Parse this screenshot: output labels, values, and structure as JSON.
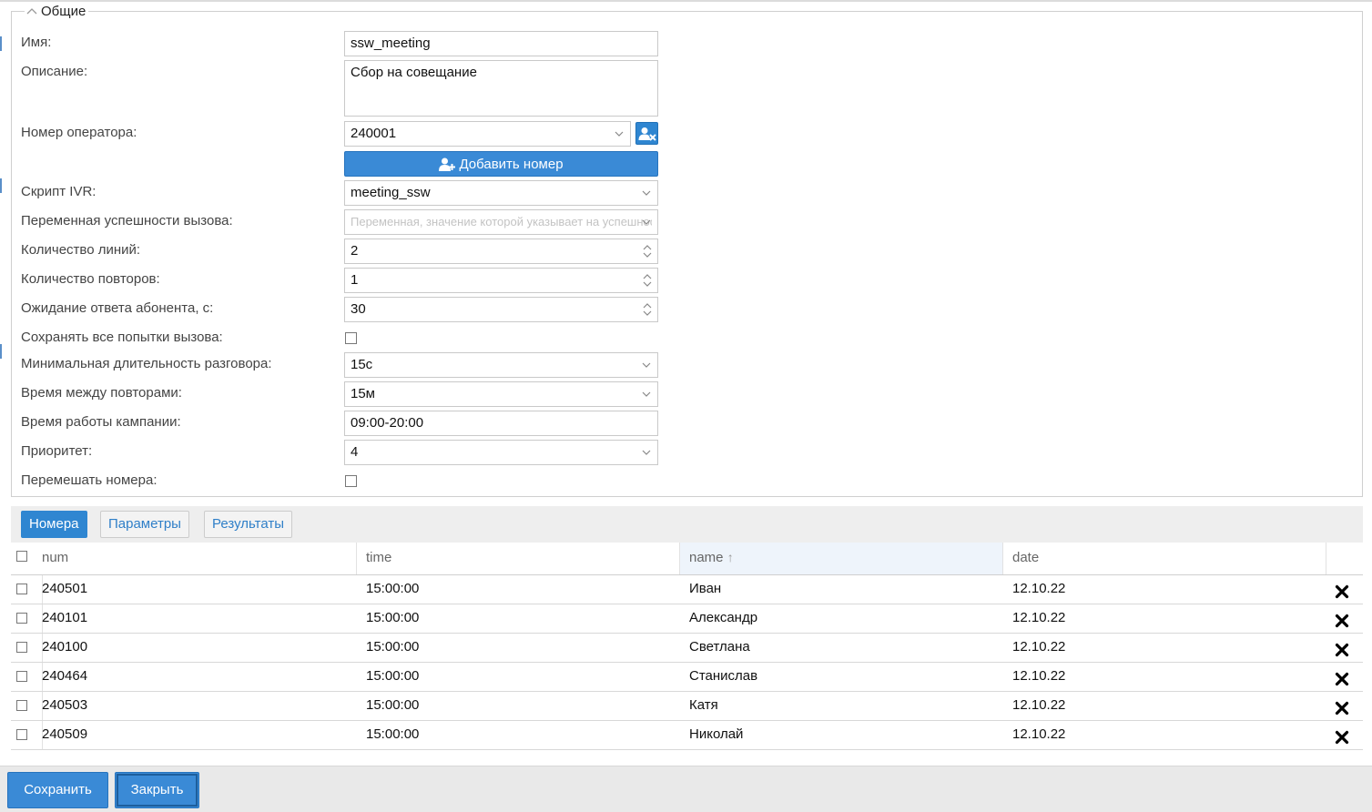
{
  "general": {
    "legend": "Общие",
    "labels": {
      "name": "Имя:",
      "description": "Описание:",
      "operator_number": "Номер оператора:",
      "ivr_script": "Скрипт IVR:",
      "success_var": "Переменная успешности вызова:",
      "lines": "Количество линий:",
      "retries": "Количество повторов:",
      "answer_wait": "Ожидание ответа абонента, с:",
      "save_attempts": "Сохранять все попытки вызова:",
      "min_duration": "Минимальная длительность разговора:",
      "retry_interval": "Время между повторами:",
      "work_time": "Время работы кампании:",
      "priority": "Приоритет:",
      "shuffle": "Перемешать номера:"
    },
    "values": {
      "name": "ssw_meeting",
      "description": "Сбор на совещание",
      "operator_number": "240001",
      "ivr_script": "meeting_ssw",
      "success_var_placeholder": "Переменная, значение которой указывает на успешность вызова",
      "lines": "2",
      "retries": "1",
      "answer_wait": "30",
      "save_attempts": false,
      "min_duration": "15с",
      "retry_interval": "15м",
      "work_time": "09:00-20:00",
      "priority": "4",
      "shuffle": false
    },
    "add_number_label": "Добавить номер"
  },
  "tabs": [
    {
      "label": "Номера",
      "active": true
    },
    {
      "label": "Параметры",
      "active": false
    },
    {
      "label": "Результаты",
      "active": false
    }
  ],
  "grid": {
    "columns": [
      "num",
      "time",
      "name",
      "date"
    ],
    "sorted_column": "name",
    "sort_indicator": "↑",
    "rows": [
      {
        "num": "240501",
        "time": "15:00:00",
        "name": "Иван",
        "date": "12.10.22"
      },
      {
        "num": "240101",
        "time": "15:00:00",
        "name": "Александр",
        "date": "12.10.22"
      },
      {
        "num": "240100",
        "time": "15:00:00",
        "name": "Светлана",
        "date": "12.10.22"
      },
      {
        "num": "240464",
        "time": "15:00:00",
        "name": "Станислав",
        "date": "12.10.22"
      },
      {
        "num": "240503",
        "time": "15:00:00",
        "name": "Катя",
        "date": "12.10.22"
      },
      {
        "num": "240509",
        "time": "15:00:00",
        "name": "Николай",
        "date": "12.10.22"
      }
    ]
  },
  "footer": {
    "save_label": "Сохранить",
    "close_label": "Закрыть"
  },
  "colors": {
    "primary": "#3a8ad6",
    "tab_link": "#2f7fc8",
    "sorted_header": "#eef4fb"
  }
}
